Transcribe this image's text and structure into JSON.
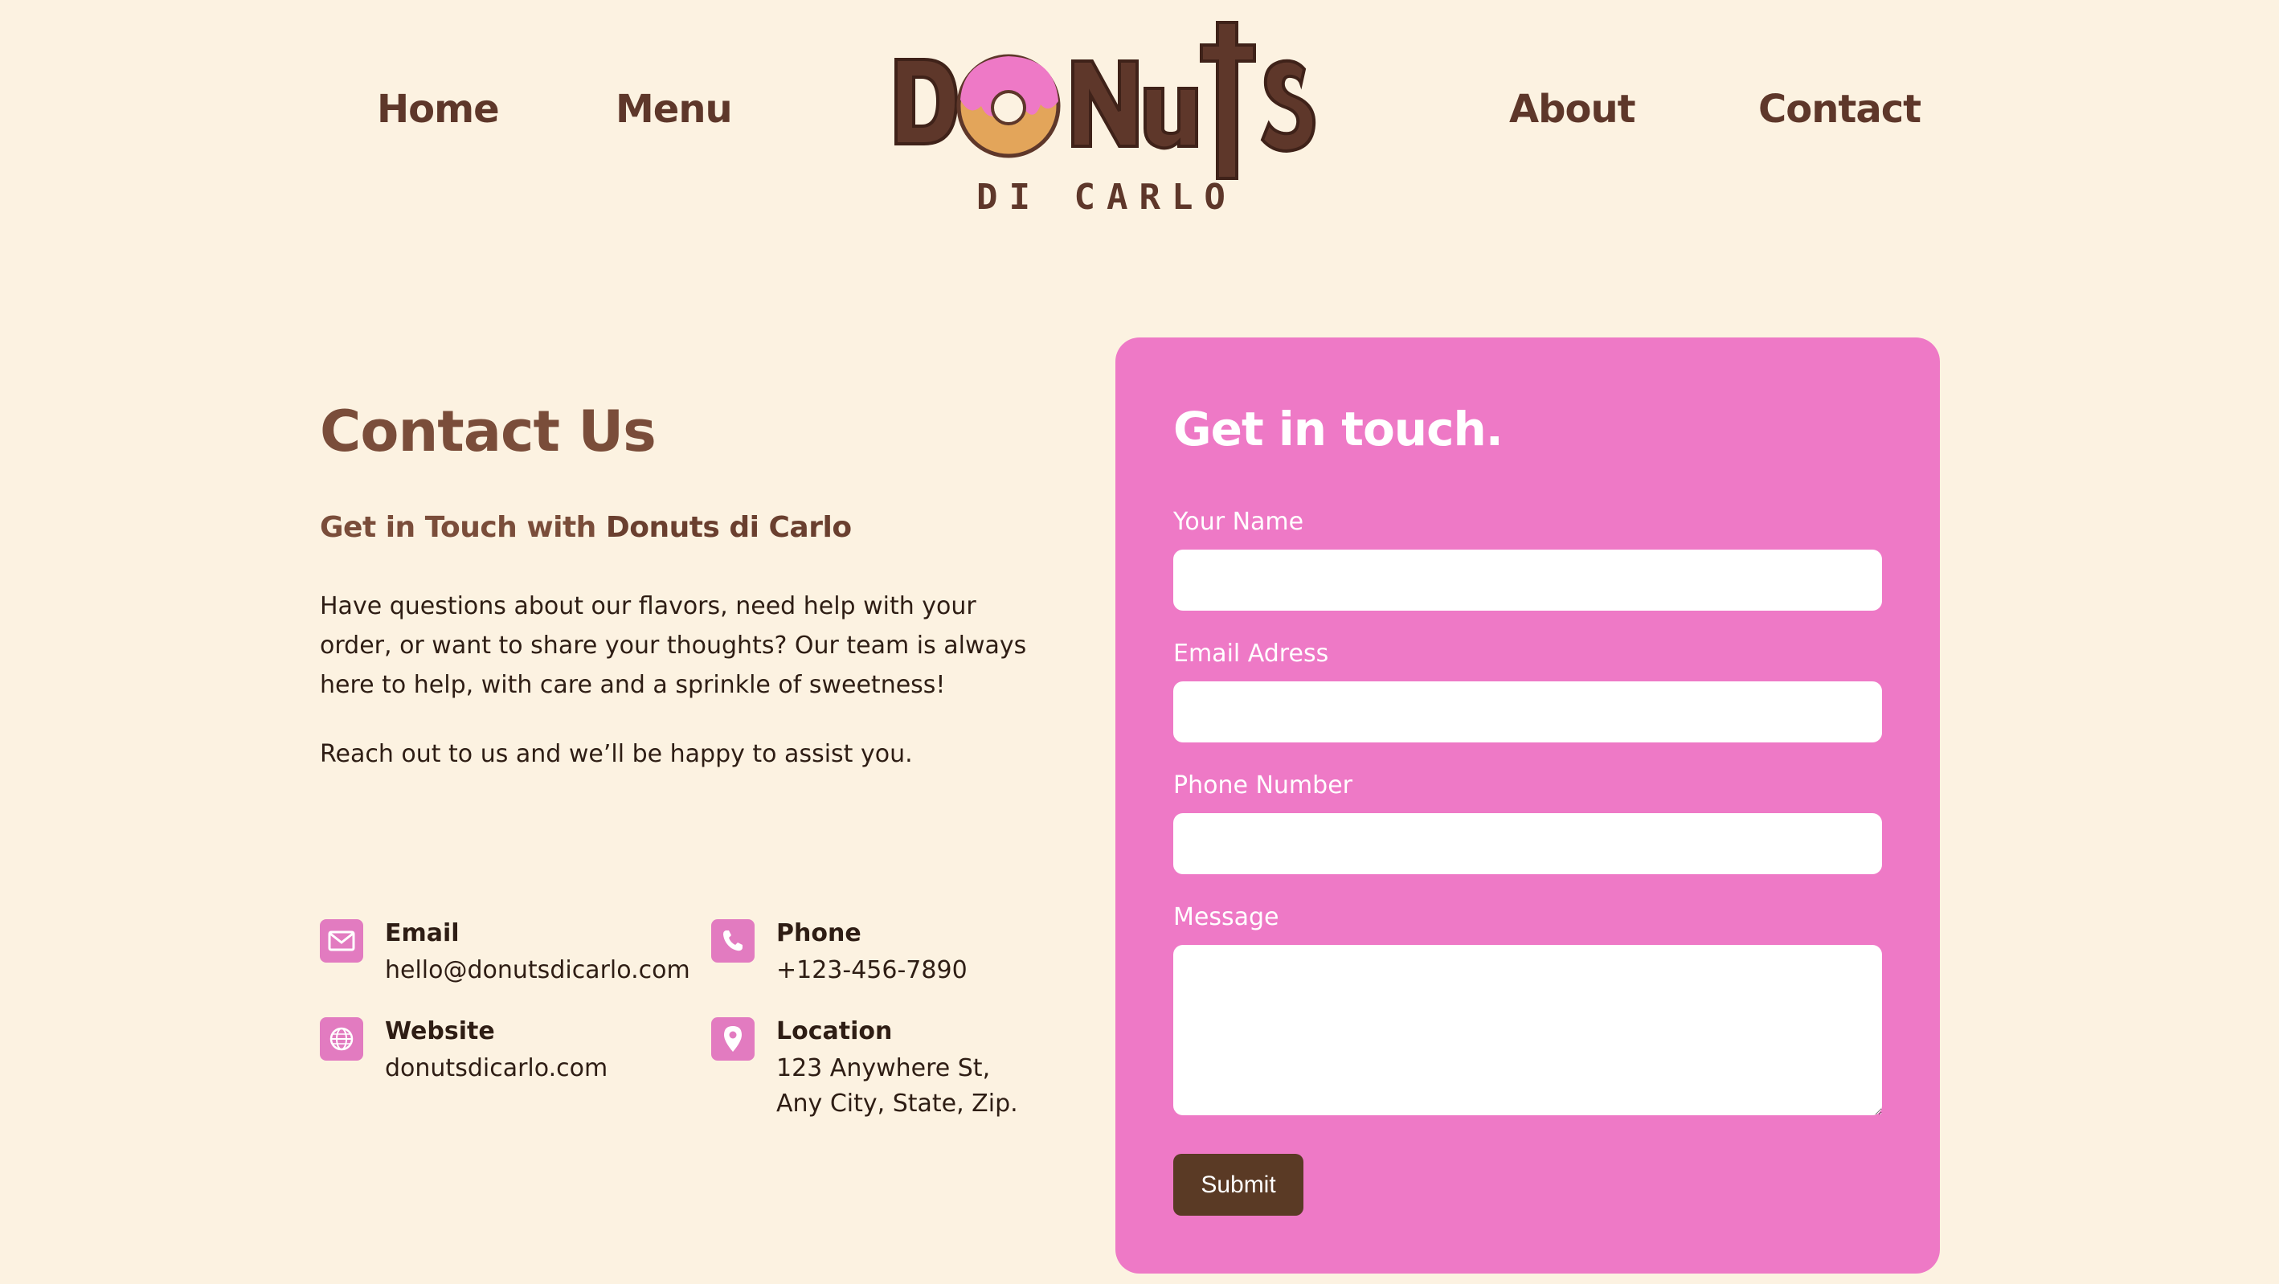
{
  "nav": {
    "home": "Home",
    "menu": "Menu",
    "about": "About",
    "contact": "Contact"
  },
  "logo": {
    "word": "DONUTS",
    "tagline": "DI CARLO"
  },
  "intro": {
    "title": "Contact Us",
    "subtitle_prefix": "Get in Touch with ",
    "subtitle_brand": "Donuts di Carlo",
    "paragraph": "Have questions about our flavors, need help with your order, or want to share your thoughts? Our team is always here to help, with care and a sprinkle of sweetness!",
    "reach_out": "Reach out to us and we’ll be happy to assist you."
  },
  "contact_info": {
    "email": {
      "label": "Email",
      "value": "hello@donutsdicarlo.com",
      "icon": "envelope-icon"
    },
    "phone": {
      "label": "Phone",
      "value": "+123-456-7890",
      "icon": "phone-icon"
    },
    "website": {
      "label": "Website",
      "value": "donutsdicarlo.com",
      "icon": "globe-icon"
    },
    "location": {
      "label": "Location",
      "line1": "123 Anywhere St,",
      "line2": "Any City, State, Zip.",
      "icon": "map-pin-icon"
    }
  },
  "form": {
    "title": "Get in touch.",
    "name_label": "Your Name",
    "name_value": "",
    "email_label": "Email Adress",
    "email_value": "",
    "phone_label": "Phone Number",
    "phone_value": "",
    "message_label": "Message",
    "message_value": "",
    "submit_label": "Submit"
  },
  "colors": {
    "background": "#fcf2e1",
    "brand_brown": "#5e372a",
    "accent_pink": "#ee79c6",
    "icon_pink": "#e27bc0",
    "donut_dough": "#e3a55a",
    "submit_brown": "#5a3a25"
  }
}
